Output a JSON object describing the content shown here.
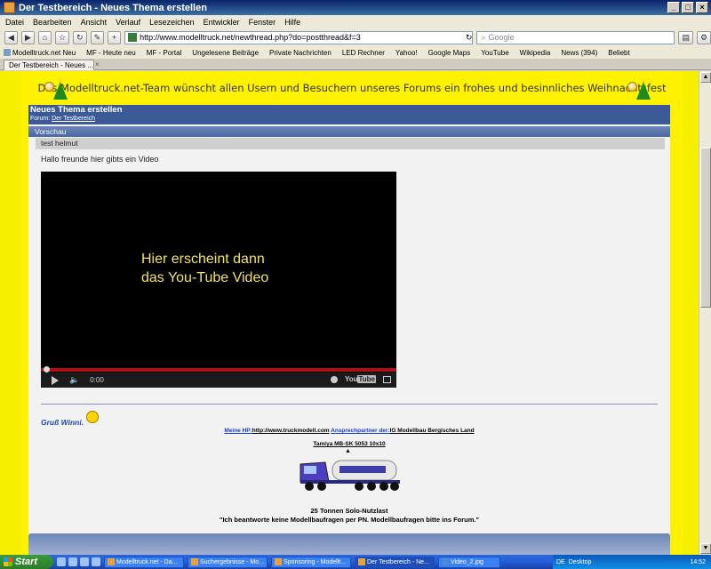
{
  "window": {
    "title": "Der Testbereich - Neues Thema erstellen"
  },
  "menu": [
    "Datei",
    "Bearbeiten",
    "Ansicht",
    "Verlauf",
    "Lesezeichen",
    "Entwickler",
    "Fenster",
    "Hilfe"
  ],
  "nav": {
    "url": "http://www.modelltruck.net/newthread.php?do=postthread&f=3",
    "search_placeholder": "Google"
  },
  "bookmarks": [
    "Modelltruck.net Neu",
    "MF - Heute neu",
    "MF - Portal",
    "Ungelesene Beiträge",
    "Private Nachrichten",
    "LED Rechner",
    "Yahoo!",
    "Google Maps",
    "YouTube",
    "Wikipedia",
    "News (394)",
    "Beliebt"
  ],
  "tab": {
    "label": "Der Testbereich - Neues ..."
  },
  "page": {
    "banner": "Das Modelltruck.net-Team wünscht allen Usern und Besuchern unseres Forums ein frohes und besinnliches Weihnachtsfest",
    "thread_title": "Neues Thema erstellen",
    "forum_label": "Forum:",
    "forum_link": "Der Testbereich",
    "preview_label": "Vorschau",
    "subject": "test helmut",
    "body": "Hallo freunde hier gibts ein Video",
    "video": {
      "line1": "Hier erscheint dann",
      "line2": "das You-Tube Video",
      "time": "0:00",
      "logo": "You",
      "logo2": "Tube"
    },
    "greeting": "Gruß Winni.",
    "sig": {
      "hp_label": "Meine HP:",
      "hp_url": "http://www.truckmodell.com",
      "partner_label": "Ansprechpartner der:",
      "partner": "IG Modellbau Bergisches Land",
      "model": "Tamiya MB-SK 5053 10x10",
      "arrow": "▲",
      "load": "25 Tonnen Solo-Nutzlast",
      "note": "\"Ich beantworte keine Modellbaufragen per PN. Modellbaufragen bitte ins Forum.\""
    }
  },
  "taskbar": {
    "start": "Start",
    "items": [
      "Modelltruck.net - Da...",
      "Suchergebnisse - Mo...",
      "Sponsoring - Modellt...",
      "Der Testbereich - Ne...",
      "Video_2.jpg"
    ],
    "lang": "DE",
    "desktop": "Desktop",
    "time": "14:52"
  },
  "colors": {
    "page_bg": "#fff200",
    "header_blue": "#3c5a96",
    "link_blue": "#1a3fc8",
    "video_text": "#f3e35a"
  }
}
